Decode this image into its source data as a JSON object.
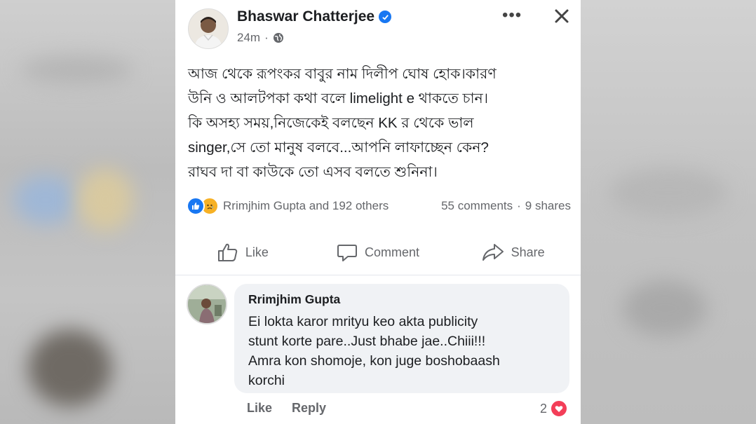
{
  "post": {
    "author": "Bhaswar Chatterjee",
    "time": "24m",
    "text": "আজ থেকে রূপংকর বাবুর নাম দিলীপ ঘোষ হোক।কারণ\nউনি ও আলটপকা কথা বলে limelight e থাকতে চান।\nকি অসহ্য সময়,নিজেকেই বলছেন KK র থেকে ভাল\nsinger,সে তো মানুষ বলবে...আপনি লাফাচ্ছেন কেন?\nরাঘব দা বা কাউকে তো এসব বলতে শুনিনা।",
    "more_icon": "more-horizontal-icon",
    "close_icon": "close-icon",
    "privacy_icon": "globe-icon"
  },
  "reactions": {
    "summary": "Rrimjhim Gupta and 192 others",
    "comments": "55 comments",
    "separator": "·",
    "shares": "9 shares"
  },
  "actions": {
    "like": "Like",
    "comment": "Comment",
    "share": "Share"
  },
  "comment": {
    "name": "Rrimjhim Gupta",
    "text": "Ei lokta karor mrityu keo akta publicity\nstunt korte pare..Just bhabe jae..Chiii!!!\nAmra kon shomoje, kon juge boshobaash\nkorchi",
    "like": "Like",
    "reply": "Reply",
    "reaction_count": "2"
  },
  "colors": {
    "accent": "#1877f2",
    "muted": "#65676b",
    "bubble": "#f0f2f5",
    "heart": "#f33e58"
  }
}
